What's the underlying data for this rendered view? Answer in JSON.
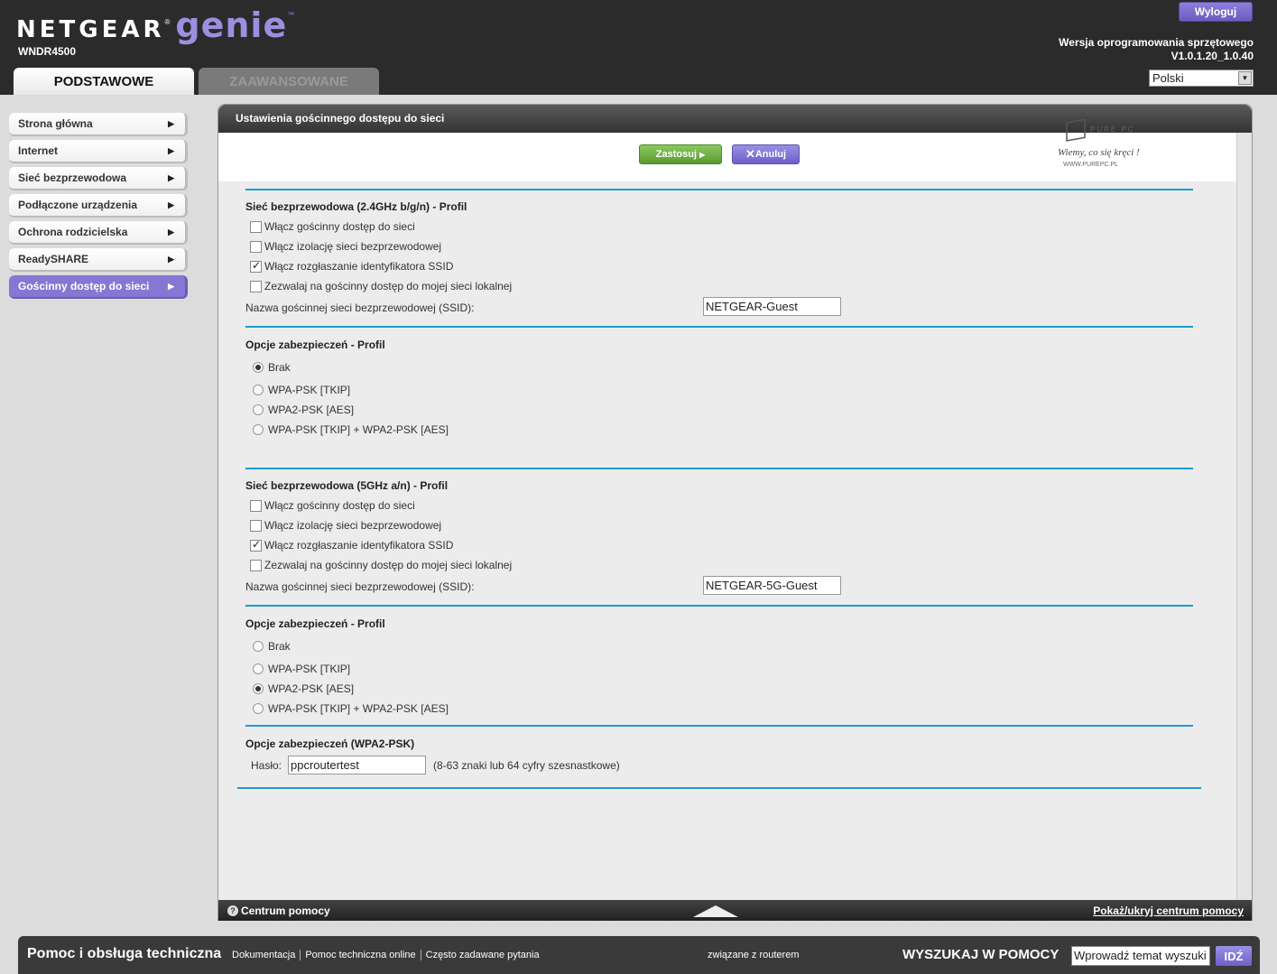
{
  "header": {
    "brand": "NETGEAR",
    "product": "genie",
    "model": "WNDR4500",
    "logout_label": "Wyloguj",
    "firmware_label": "Wersja oprogramowania sprzętowego",
    "firmware_version": "V1.0.1.20_1.0.40",
    "language": "Polski",
    "tabs": [
      "PODSTAWOWE",
      "ZAAWANSOWANE"
    ]
  },
  "sidebar": {
    "items": [
      {
        "label": "Strona główna"
      },
      {
        "label": "Internet"
      },
      {
        "label": "Sieć bezprzewodowa"
      },
      {
        "label": "Podłączone urządzenia"
      },
      {
        "label": "Ochrona rodzicielska"
      },
      {
        "label": "ReadySHARE"
      },
      {
        "label": "Gościnny dostęp do sieci"
      }
    ]
  },
  "panel": {
    "title": "Ustawienia gościnnego dostępu do sieci",
    "apply_label": "Zastosuj",
    "cancel_label": "Anuluj",
    "watermark": "PURE PC",
    "watermark_sub": "Wiemy, co się kręci !",
    "watermark_url": "WWW.PUREPC.PL"
  },
  "band24": {
    "title": "Sieć bezprzewodowa (2.4GHz b/g/n) - Profil",
    "options": [
      {
        "label": "Włącz gościnny dostęp do sieci",
        "checked": false
      },
      {
        "label": "Włącz izolację sieci bezprzewodowej",
        "checked": false
      },
      {
        "label": "Włącz rozgłaszanie identyfikatora SSID",
        "checked": true
      },
      {
        "label": "Zezwalaj na gościnny dostęp do mojej sieci lokalnej",
        "checked": false
      }
    ],
    "ssid_label": "Nazwa gościnnej sieci bezprzewodowej (SSID):",
    "ssid_value": "NETGEAR-Guest",
    "security_title": "Opcje zabezpieczeń - Profil",
    "security": [
      {
        "label": "Brak",
        "selected": true
      },
      {
        "label": "WPA-PSK [TKIP]",
        "selected": false
      },
      {
        "label": "WPA2-PSK [AES]",
        "selected": false
      },
      {
        "label": "WPA-PSK [TKIP] + WPA2-PSK [AES]",
        "selected": false
      }
    ]
  },
  "band5": {
    "title": "Sieć bezprzewodowa (5GHz a/n) - Profil",
    "options": [
      {
        "label": "Włącz gościnny dostęp do sieci",
        "checked": false
      },
      {
        "label": "Włącz izolację sieci bezprzewodowej",
        "checked": false
      },
      {
        "label": "Włącz rozgłaszanie identyfikatora SSID",
        "checked": true
      },
      {
        "label": "Zezwalaj na gościnny dostęp do mojej sieci lokalnej",
        "checked": false
      }
    ],
    "ssid_label": "Nazwa gościnnej sieci bezprzewodowej (SSID):",
    "ssid_value": "NETGEAR-5G-Guest",
    "security_title": "Opcje zabezpieczeń - Profil",
    "security": [
      {
        "label": "Brak",
        "selected": false
      },
      {
        "label": "WPA-PSK [TKIP]",
        "selected": false
      },
      {
        "label": "WPA2-PSK [AES]",
        "selected": true
      },
      {
        "label": "WPA-PSK [TKIP] + WPA2-PSK [AES]",
        "selected": false
      }
    ]
  },
  "wpa2": {
    "title": "Opcje zabezpieczeń (WPA2-PSK)",
    "password_label": "Hasło:",
    "password_value": "ppcroutertest",
    "password_hint": "(8-63 znaki lub 64 cyfry szesnastkowe)"
  },
  "helpbar": {
    "left": "Centrum pomocy",
    "right": "Pokaż/ukryj centrum pomocy"
  },
  "footer": {
    "title": "Pomoc i obsługa techniczna",
    "links": [
      "Dokumentacja",
      "Pomoc techniczna online",
      "Często zadawane pytania"
    ],
    "related": "związane z routerem",
    "search_label": "WYSZUKAJ W POMOCY",
    "search_placeholder": "Wprowadź temat wyszuki",
    "go_label": "IDŹ"
  }
}
